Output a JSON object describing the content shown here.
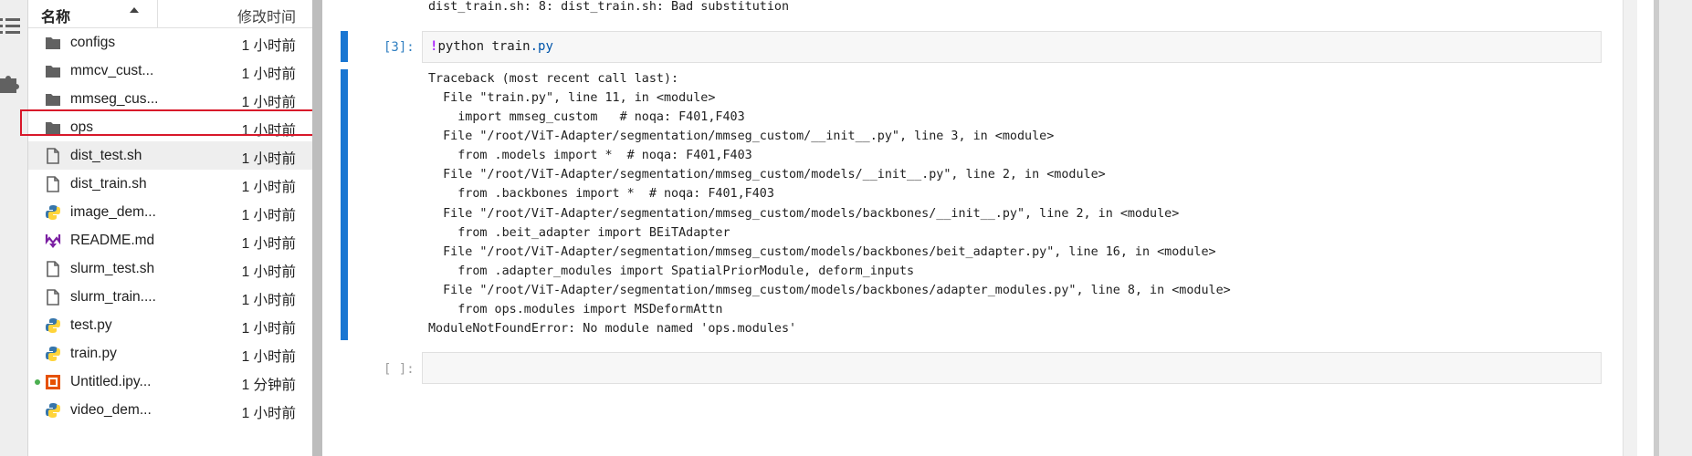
{
  "file_browser": {
    "header": {
      "name_label": "名称",
      "modified_label": "修改时间"
    },
    "rows": [
      {
        "name": "configs",
        "time": "1 小时前",
        "icon": "folder-icon"
      },
      {
        "name": "mmcv_cust...",
        "time": "1 小时前",
        "icon": "folder-icon"
      },
      {
        "name": "mmseg_cus...",
        "time": "1 小时前",
        "icon": "folder-icon"
      },
      {
        "name": "ops",
        "time": "1 小时前",
        "icon": "folder-icon"
      },
      {
        "name": "dist_test.sh",
        "time": "1 小时前",
        "icon": "file-icon"
      },
      {
        "name": "dist_train.sh",
        "time": "1 小时前",
        "icon": "file-icon"
      },
      {
        "name": "image_dem...",
        "time": "1 小时前",
        "icon": "python-icon"
      },
      {
        "name": "README.md",
        "time": "1 小时前",
        "icon": "markdown-icon"
      },
      {
        "name": "slurm_test.sh",
        "time": "1 小时前",
        "icon": "file-icon"
      },
      {
        "name": "slurm_train....",
        "time": "1 小时前",
        "icon": "file-icon"
      },
      {
        "name": "test.py",
        "time": "1 小时前",
        "icon": "python-icon"
      },
      {
        "name": "train.py",
        "time": "1 小时前",
        "icon": "python-icon"
      },
      {
        "name": "Untitled.ipy...",
        "time": "1 分钟前",
        "icon": "notebook-icon"
      },
      {
        "name": "video_dem...",
        "time": "1 小时前",
        "icon": "python-icon"
      }
    ]
  },
  "notebook": {
    "top_output": "dist_train.sh: 8: dist_train.sh: Bad substitution",
    "cell": {
      "prompt": "[3]:",
      "code_bang": "!",
      "code_cmd": "python train",
      "code_ext": ".py",
      "output_lines": [
        "Traceback (most recent call last):",
        "  File \"train.py\", line 11, in <module>",
        "    import mmseg_custom   # noqa: F401,F403",
        "  File \"/root/ViT-Adapter/segmentation/mmseg_custom/__init__.py\", line 3, in <module>",
        "    from .models import *  # noqa: F401,F403",
        "  File \"/root/ViT-Adapter/segmentation/mmseg_custom/models/__init__.py\", line 2, in <module>",
        "    from .backbones import *  # noqa: F401,F403",
        "  File \"/root/ViT-Adapter/segmentation/mmseg_custom/models/backbones/__init__.py\", line 2, in <module>",
        "    from .beit_adapter import BEiTAdapter",
        "  File \"/root/ViT-Adapter/segmentation/mmseg_custom/models/backbones/beit_adapter.py\", line 16, in <module>",
        "    from .adapter_modules import SpatialPriorModule, deform_inputs",
        "  File \"/root/ViT-Adapter/segmentation/mmseg_custom/models/backbones/adapter_modules.py\", line 8, in <module>",
        "    from ops.modules import MSDeformAttn",
        "ModuleNotFoundError: No module named 'ops.modules'"
      ]
    },
    "empty_cell": {
      "prompt": "[ ]:"
    }
  },
  "colors": {
    "accent": "#1976d2",
    "highlight": "#d8182a",
    "python_blue": "#3776ab",
    "python_yellow": "#ffd43b",
    "markdown_purple": "#7b1fa2",
    "notebook_orange": "#e65100"
  }
}
